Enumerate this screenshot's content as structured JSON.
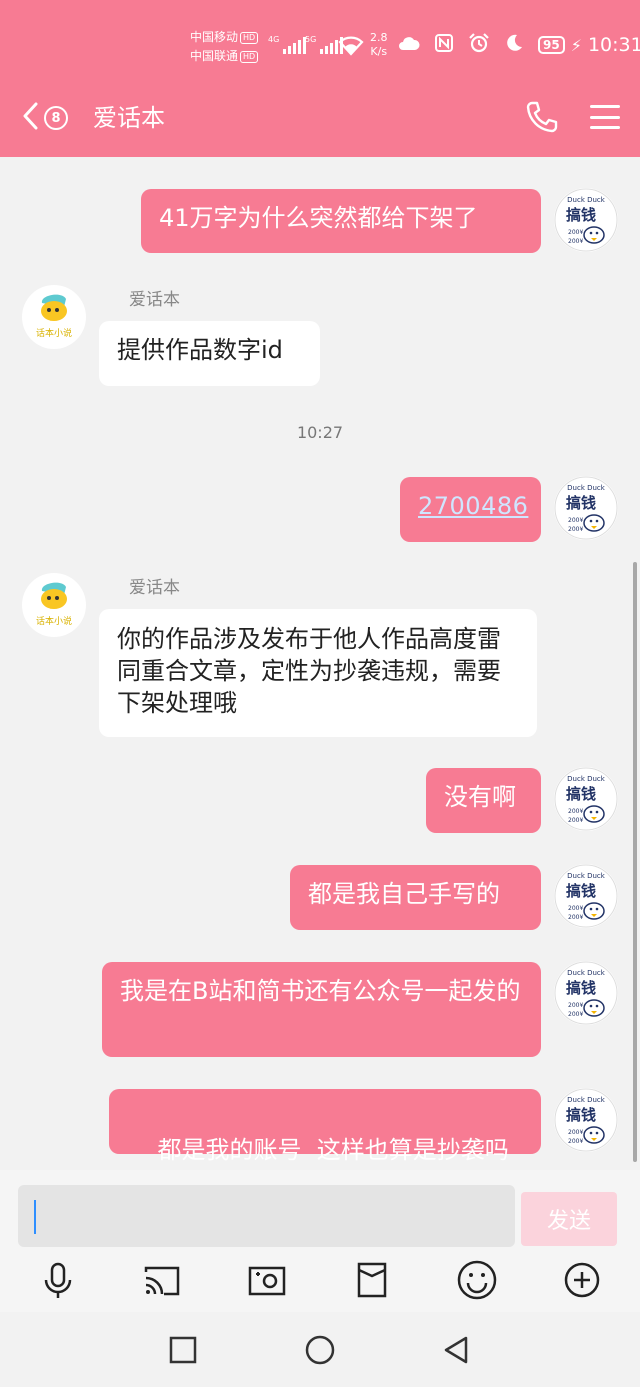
{
  "status_bar": {
    "carrier1": "中国移动",
    "carrier2": "中国联通",
    "hd": "HD",
    "net1": "4G",
    "net2": "5G",
    "speed_value": "2.8",
    "speed_unit": "K/s",
    "battery": "95",
    "time": "10:31"
  },
  "header": {
    "unread_count": "8",
    "title": "爱话本"
  },
  "chat": {
    "timestamp": "10:27",
    "messages": [
      {
        "from": "me",
        "text": "41万字为什么突然都给下架了"
      },
      {
        "from": "other",
        "sender": "爱话本",
        "text": "提供作品数字id"
      },
      {
        "from": "me",
        "text": "2700486"
      },
      {
        "from": "other",
        "sender": "爱话本",
        "text": "你的作品涉及发布于他人作品高度雷同重合文章，定性为抄袭违规，需要下架处理哦"
      },
      {
        "from": "me",
        "text": "没有啊"
      },
      {
        "from": "me",
        "text": "都是我自己手写的"
      },
      {
        "from": "me",
        "text": "我是在B站和简书还有公众号一起发的"
      },
      {
        "from": "me",
        "text": "都是我的账号  这样也算是抄袭吗"
      }
    ],
    "avatar_me_text": "搞钱",
    "avatar_me_small": "Duck Duck",
    "avatar_other_text": "话本小说"
  },
  "input": {
    "value": "",
    "send_label": "发送"
  },
  "toolbar_icons": [
    "microphone-icon",
    "cast-icon",
    "camera-icon",
    "file-icon",
    "emoji-icon",
    "plus-icon"
  ],
  "colors": {
    "brand": "#f77b93",
    "send_disabled": "#fbd3dc"
  }
}
